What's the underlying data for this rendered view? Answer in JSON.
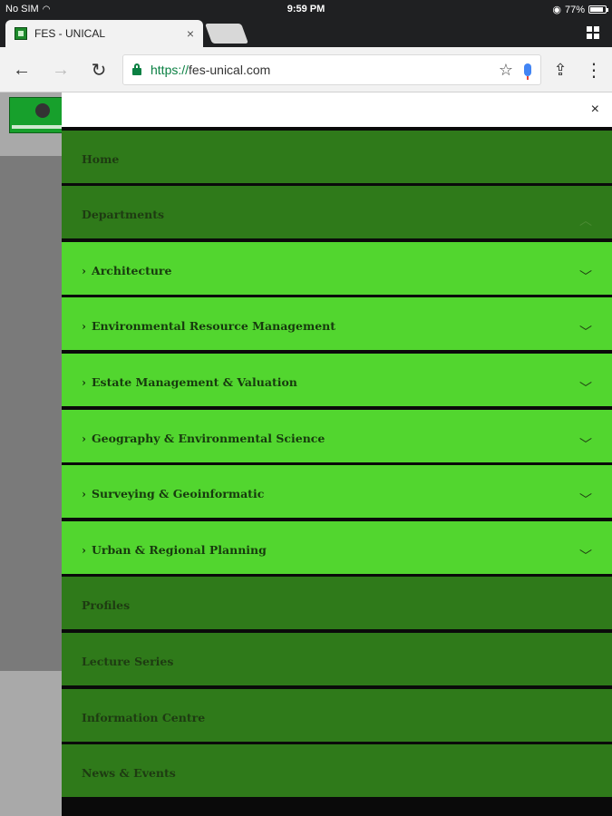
{
  "status_bar": {
    "carrier": "No SIM",
    "time": "9:59 PM",
    "battery": "77%",
    "battery_level": 0.77
  },
  "tab": {
    "title": "FES - UNICAL",
    "close": "×"
  },
  "toolbar": {
    "back": "←",
    "forward": "→",
    "reload": "↻",
    "url_scheme": "https://",
    "url_host": "fes-unical.com",
    "star": "☆",
    "share": "⇪",
    "menu": "⋮"
  },
  "drawer": {
    "close": "×",
    "items": [
      {
        "label": "Home",
        "type": "top"
      },
      {
        "label": "Departments",
        "type": "top",
        "expanded": true
      },
      {
        "label": "Architecture",
        "type": "sub"
      },
      {
        "label": "Environmental Resource Management",
        "type": "sub"
      },
      {
        "label": "Estate Management & Valuation",
        "type": "sub"
      },
      {
        "label": "Geography & Environmental Science",
        "type": "sub"
      },
      {
        "label": "Surveying & Geoinformatic",
        "type": "sub"
      },
      {
        "label": "Urban & Regional Planning",
        "type": "sub"
      },
      {
        "label": "Profiles",
        "type": "top"
      },
      {
        "label": "Lecture Series",
        "type": "top"
      },
      {
        "label": "Information Centre",
        "type": "top"
      },
      {
        "label": "News & Events",
        "type": "top"
      }
    ]
  },
  "colors": {
    "top_item": "#2f7a1a",
    "sub_item": "#52d62f",
    "separator": "#0a0a0a"
  }
}
